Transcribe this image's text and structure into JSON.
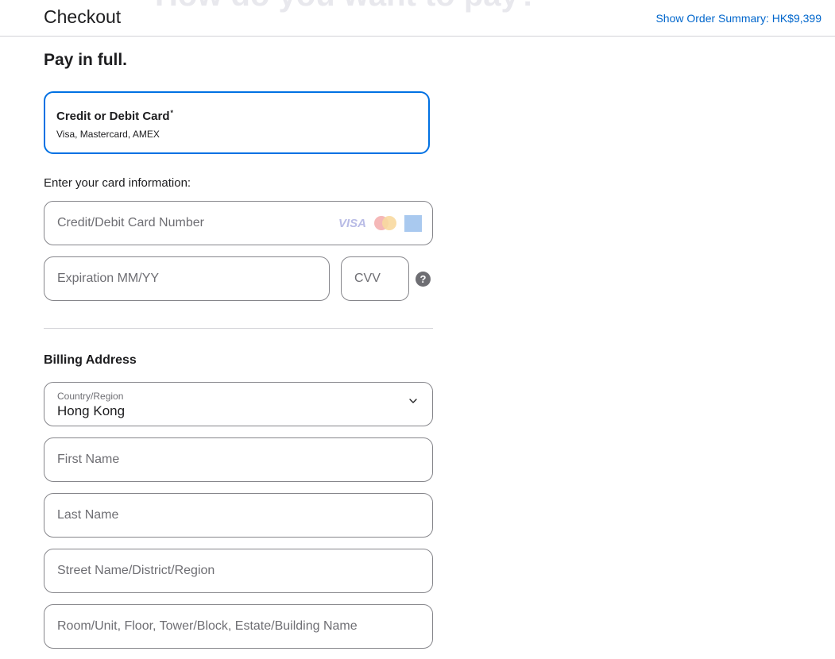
{
  "header": {
    "background_heading": "How do you want to pay?",
    "title": "Checkout",
    "order_summary_link": "Show Order Summary: HK$9,399"
  },
  "payment": {
    "section_title": "Pay in full.",
    "option": {
      "name": "Credit or Debit Card",
      "marker": "*",
      "subtitle": "Visa, Mastercard, AMEX",
      "selected": true
    },
    "card_info_label": "Enter your card information:",
    "card_number_placeholder": "Credit/Debit Card Number",
    "expiration_placeholder": "Expiration MM/YY",
    "cvv_placeholder": "CVV",
    "help_glyph": "?",
    "card_logos": {
      "visa": "VISA",
      "amex": "AMERICAN EXPRESS"
    }
  },
  "billing": {
    "title": "Billing Address",
    "country_label": "Country/Region",
    "country_value": "Hong Kong",
    "first_name_placeholder": "First Name",
    "last_name_placeholder": "Last Name",
    "street_placeholder": "Street Name/District/Region",
    "room_placeholder": "Room/Unit, Floor, Tower/Block, Estate/Building Name"
  },
  "colors": {
    "accent": "#0071e3",
    "link": "#0066cc",
    "text": "#1d1d1f",
    "placeholder": "#6e6e73",
    "border": "#86868b"
  },
  "icons": {
    "card_logos": [
      "visa-icon",
      "mastercard-icon",
      "amex-icon"
    ],
    "help": "question-icon",
    "select": "chevron-down-icon"
  }
}
